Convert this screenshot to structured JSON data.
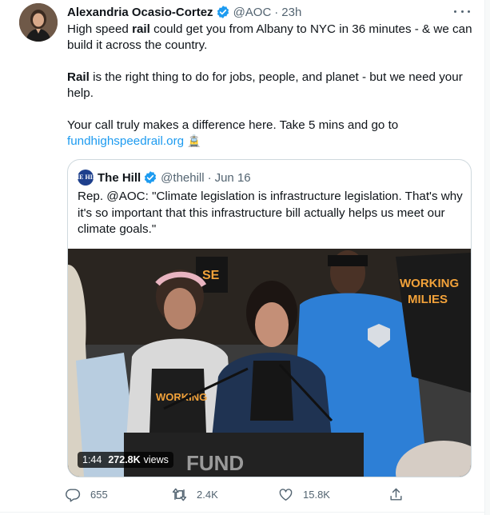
{
  "colors": {
    "accent": "#1d9bf0",
    "text": "#0f1419",
    "secondary": "#536471",
    "border": "#cfd9de"
  },
  "tweet": {
    "author_name": "Alexandria Ocasio-Cortez",
    "handle": "@AOC",
    "separator": "·",
    "time": "23h",
    "verified_icon": "verified-badge-icon",
    "more_icon": "more-options-icon",
    "body": {
      "p1_pre": "High speed ",
      "p1_bold": "rail",
      "p1_post": " could get you from Albany to NYC in 36 minutes - & we can build it across the country.",
      "p2_bold": "Rail",
      "p2_post": " is the right thing to do for jobs, people, and planet - but we need your help.",
      "p3_text": "Your call truly makes a difference here. Take 5 mins and go to",
      "link": "fundhighspeedrail.org",
      "emoji": "🚊"
    }
  },
  "quote": {
    "logo_text": "THE HILL",
    "author_name": "The Hill",
    "handle": "@thehill",
    "separator": "·",
    "date": "Jun 16",
    "text": "Rep. @AOC: \"Climate legislation is infrastructure legislation. That's why it's so important that this infrastructure bill actually helps us meet our climate goals.\"",
    "media": {
      "duration": "1:44",
      "views": "272.8K",
      "views_label": "views",
      "sign_text": "FUND",
      "shirt_text": "WORKING FAMILIES"
    }
  },
  "actions": {
    "reply_count": "655",
    "retweet_count": "2.4K",
    "like_count": "15.8K",
    "reply_icon": "reply-icon",
    "retweet_icon": "retweet-icon",
    "like_icon": "like-icon",
    "share_icon": "share-icon"
  }
}
